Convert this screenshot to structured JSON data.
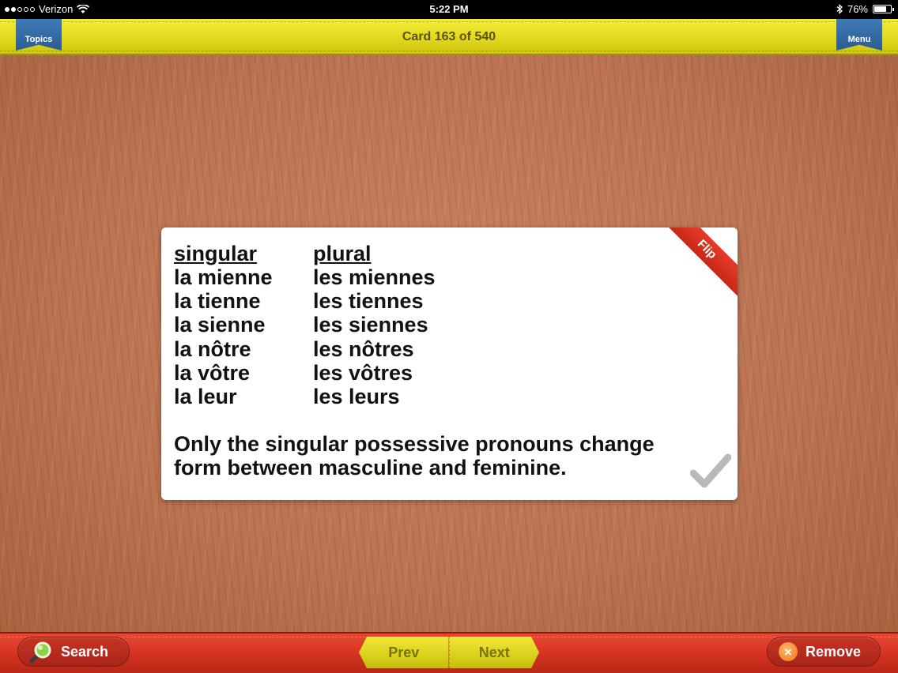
{
  "status_bar": {
    "carrier": "Verizon",
    "time": "5:22 PM",
    "battery": "76%",
    "battery_fraction": 0.76
  },
  "top_bar": {
    "topics_label": "Topics",
    "card_counter": "Card 163 of 540",
    "menu_label": "Menu"
  },
  "card": {
    "flip_label": "Flip",
    "singular_header": "singular",
    "plural_header": "plural",
    "singular": [
      "la mienne",
      "la tienne",
      "la sienne",
      "la nôtre",
      "la vôtre",
      "la leur"
    ],
    "plural": [
      "les miennes",
      "les tiennes",
      "les siennes",
      "les nôtres",
      "les vôtres",
      "les leurs"
    ],
    "note_line1": "Only the singular possessive pronouns change",
    "note_line2": "form between masculine and feminine.",
    "check_icon": "checkmark-icon"
  },
  "bottom_bar": {
    "search_label": "Search",
    "prev_label": "Prev",
    "next_label": "Next",
    "remove_label": "Remove"
  },
  "colors": {
    "top_bar": "#e2d91f",
    "bottom_bar": "#d23220",
    "ribbon": "#2c5c92",
    "flip_ribbon": "#d9301f"
  }
}
